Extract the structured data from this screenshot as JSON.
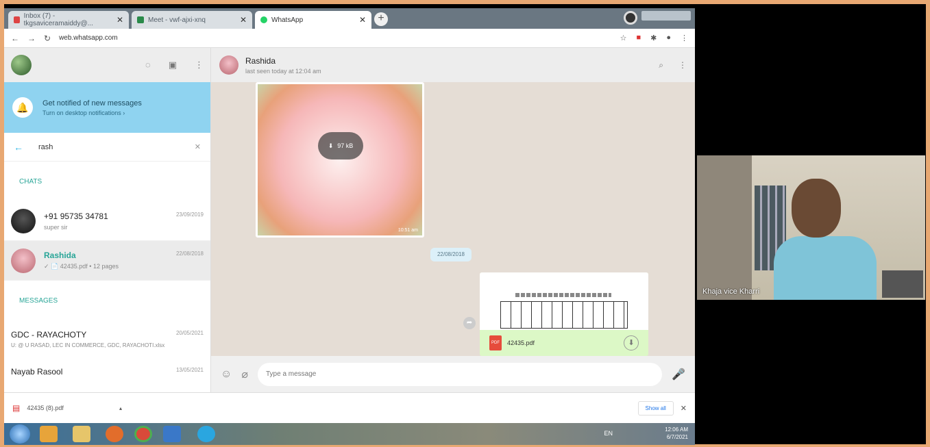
{
  "browser": {
    "tabs": [
      {
        "label": "Inbox (7) - tkgsaviceramaiddy@..."
      },
      {
        "label": "Meet - vwf-ajxi-xnq"
      },
      {
        "label": "WhatsApp"
      }
    ],
    "url": "web.whatsapp.com"
  },
  "whatsapp": {
    "notification": {
      "title": "Get notified of new messages",
      "subtitle": "Turn on desktop notifications ›"
    },
    "search_value": "rash",
    "chats_header": "CHATS",
    "messages_header": "MESSAGES",
    "chats": [
      {
        "name": "+91 95735 34781",
        "date": "23/09/2019",
        "sub": "super sir"
      },
      {
        "name": "Rashida",
        "date": "22/08/2018",
        "sub": "✓ 📄 42435.pdf • 12 pages"
      }
    ],
    "messages": [
      {
        "name": "GDC - RAYACHOTY",
        "date": "20/05/2021",
        "sub": "U: @ U RASAD, LEC IN COMMERCE, GDC, RAYACHOTI.xlsx"
      },
      {
        "name": "Nayab Rasool",
        "date": "13/05/2021",
        "sub": ""
      }
    ],
    "conversation": {
      "contact": "Rashida",
      "last_seen": "last seen today at 12:04 am",
      "image_download": "97 kB",
      "image_time": "10:51 am",
      "date_pill": "22/08/2018",
      "doc_name": "42435.pdf",
      "compose_placeholder": "Type a message"
    }
  },
  "downloads": {
    "file": "42435 (8).pdf",
    "show_all": "Show all"
  },
  "taskbar": {
    "lang": "EN",
    "time": "12:06 AM",
    "date": "6/7/2021"
  },
  "video": {
    "participant": "Khaja vice Kharri"
  }
}
